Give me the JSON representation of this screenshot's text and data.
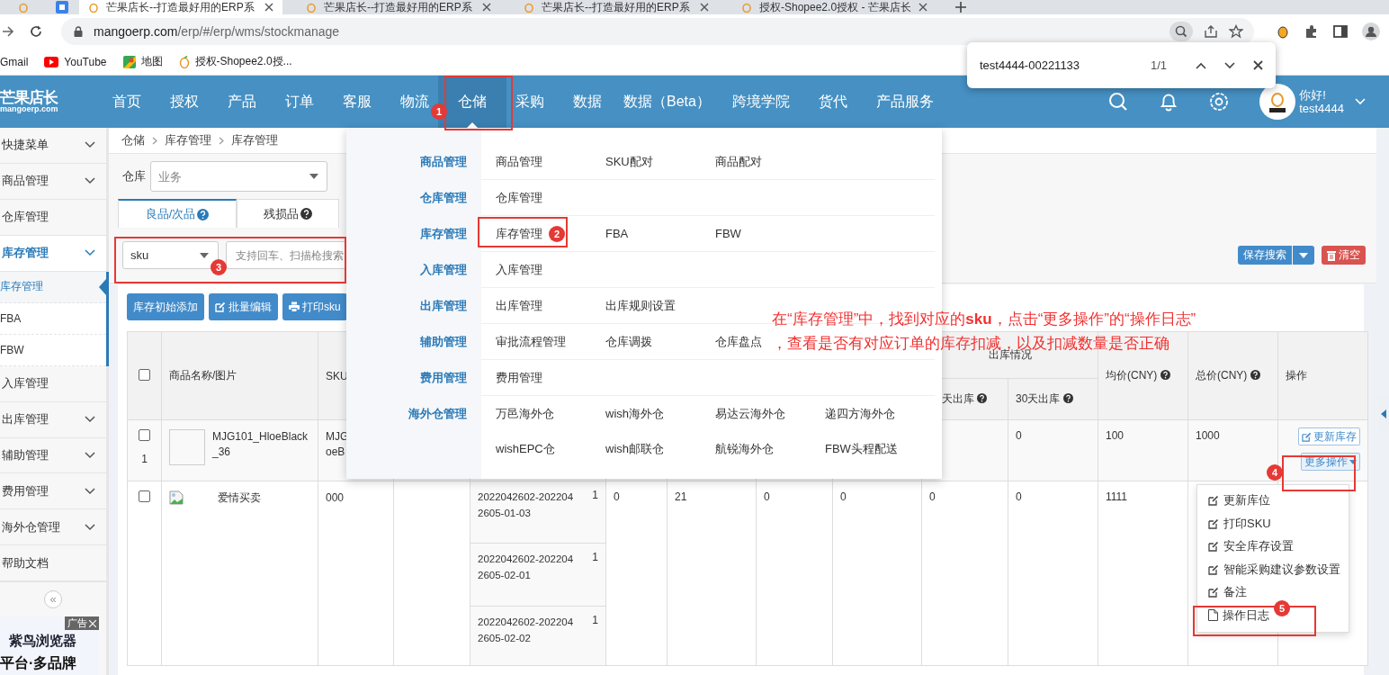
{
  "browser": {
    "tabs": [
      {
        "title": "芒果店长--打造最好用的ERP系",
        "selected": true
      },
      {
        "title": "芒果店长--打造最好用的ERP系",
        "selected": false
      },
      {
        "title": "芒果店长--打造最好用的ERP系",
        "selected": false
      },
      {
        "title": "授权-Shopee2.0授权 - 芒果店长",
        "selected": false
      }
    ],
    "url_host": "mangoerp.com",
    "url_path": "/erp/#/erp/wms/stockmanage",
    "bookmarks": [
      {
        "label": "Gmail",
        "kind": "gmail"
      },
      {
        "label": "YouTube",
        "kind": "youtube"
      },
      {
        "label": "地图",
        "kind": "maps"
      },
      {
        "label": "授权-Shopee2.0授...",
        "kind": "mango"
      }
    ],
    "find_bar": {
      "query": "test4444-00221133",
      "count": "1/1"
    }
  },
  "header": {
    "logo": {
      "name": "芒果店长",
      "domain": "mangoerp.com"
    },
    "nav": [
      {
        "label": "首页",
        "selected": false
      },
      {
        "label": "授权",
        "selected": false
      },
      {
        "label": "产品",
        "selected": false
      },
      {
        "label": "订单",
        "selected": false
      },
      {
        "label": "客服",
        "selected": false
      },
      {
        "label": "物流",
        "selected": false
      },
      {
        "label": "仓储",
        "selected": true
      },
      {
        "label": "采购",
        "selected": false
      },
      {
        "label": "数据",
        "selected": false
      },
      {
        "label": "数据（Beta）",
        "selected": false
      },
      {
        "label": "跨境学院",
        "selected": false
      },
      {
        "label": "货代",
        "selected": false
      },
      {
        "label": "产品服务",
        "selected": false
      }
    ],
    "user": {
      "greeting": "你好!",
      "name": "test4444"
    }
  },
  "sidebar": {
    "items": [
      {
        "label": "快捷菜单",
        "kind": "group",
        "expanded": false,
        "selected": false
      },
      {
        "label": "商品管理",
        "kind": "group",
        "expanded": false,
        "selected": false
      },
      {
        "label": "仓库管理",
        "kind": "link",
        "selected": false
      },
      {
        "label": "库存管理",
        "kind": "group",
        "expanded": true,
        "selected": true,
        "children": [
          {
            "label": "库存管理",
            "selected": true
          },
          {
            "label": "FBA",
            "selected": false
          },
          {
            "label": "FBW",
            "selected": false
          }
        ]
      },
      {
        "label": "入库管理",
        "kind": "link",
        "selected": false
      },
      {
        "label": "出库管理",
        "kind": "group",
        "expanded": false,
        "selected": false
      },
      {
        "label": "辅助管理",
        "kind": "group",
        "expanded": false,
        "selected": false
      },
      {
        "label": "费用管理",
        "kind": "group",
        "expanded": false,
        "selected": false
      },
      {
        "label": "海外仓管理",
        "kind": "group",
        "expanded": false,
        "selected": false
      },
      {
        "label": "帮助文档",
        "kind": "link",
        "selected": false
      }
    ],
    "collapse": "«",
    "ad": {
      "badge": "广告",
      "title": "紫鸟浏览器",
      "subtitle": "平台·多品牌"
    }
  },
  "breadcrumb": [
    "仓储",
    "库存管理",
    "库存管理"
  ],
  "filters": {
    "warehouse": {
      "label": "仓库",
      "placeholder": "业务"
    },
    "tabs": [
      {
        "label": "良品/次品",
        "selected": true
      },
      {
        "label": "残损品",
        "selected": false
      }
    ],
    "search": {
      "field": "sku",
      "placeholder": "支持回车、扫描枪搜索"
    },
    "save_search": "保存搜索",
    "clear": "清空"
  },
  "toolbar": [
    {
      "label": "库存初始添加",
      "kind": "plain"
    },
    {
      "label": "批量编辑",
      "kind": "edit"
    },
    {
      "label": "打印sku",
      "kind": "print"
    }
  ],
  "table": {
    "select_all_checked": false,
    "header": {
      "name": "商品名称/图片",
      "sku": "SKU",
      "outbound_group": "出库情况",
      "outbound_1": "天出库",
      "outbound_2": "30天出库",
      "avg_price": "均价(CNY)",
      "total_price": "总价(CNY)",
      "actions": "操作"
    },
    "rows": [
      {
        "checked": false,
        "number": "1",
        "image": {
          "kind": "placeholder"
        },
        "name": "MJG101_HloeBlack_36",
        "sku": "MJG\noeB",
        "outbound_2": "0",
        "avg_price": "100",
        "total_price": "1000",
        "actions": [
          "更新库存",
          "更多操作"
        ]
      },
      {
        "checked": false,
        "image": {
          "kind": "broken"
        },
        "name": "爱情买卖",
        "sku": "000",
        "batches": [
          {
            "code": "2022042602-2022042605-01-03",
            "qty": "1"
          },
          {
            "code": "2022042602-2022042605-02-01",
            "qty": "1"
          },
          {
            "code": "2022042602-2022042605-02-02",
            "qty": "1"
          }
        ],
        "column_6": "0",
        "column_7": "21",
        "column_8": "0",
        "column_9": "0",
        "outbound_1": "0",
        "outbound_2": "0",
        "avg_price": "1111"
      }
    ]
  },
  "mega_menu": {
    "sections": [
      {
        "label": "商品管理",
        "items": [
          "商品管理",
          "SKU配对",
          "商品配对"
        ]
      },
      {
        "label": "仓库管理",
        "items": [
          "仓库管理"
        ]
      },
      {
        "label": "库存管理",
        "items": [
          "库存管理",
          "FBA",
          "FBW"
        ]
      },
      {
        "label": "入库管理",
        "items": [
          "入库管理"
        ]
      },
      {
        "label": "出库管理",
        "items": [
          "出库管理",
          "出库规则设置"
        ]
      },
      {
        "label": "辅助管理",
        "items": [
          "审批流程管理",
          "仓库调拨",
          "仓库盘点"
        ]
      },
      {
        "label": "费用管理",
        "items": [
          "费用管理"
        ]
      },
      {
        "label": "海外仓管理",
        "items": [
          "万邑海外仓",
          "wish海外仓",
          "易达云海外仓",
          "递四方海外仓",
          "wishEPC仓",
          "wish邮联仓",
          "航锐海外仓",
          "FBW头程配送"
        ]
      }
    ]
  },
  "more_menu": [
    {
      "label": "更新库位",
      "kind": "edit"
    },
    {
      "label": "打印SKU",
      "kind": "edit"
    },
    {
      "label": "安全库存设置",
      "kind": "edit"
    },
    {
      "label": "智能采购建议参数设置",
      "kind": "edit"
    },
    {
      "label": "备注",
      "kind": "edit"
    },
    {
      "label": "操作日志",
      "kind": "file"
    }
  ],
  "annotations": {
    "steps": [
      "1",
      "2",
      "3",
      "4",
      "5"
    ],
    "note": [
      "在“库存管理”中，找到对应的**sku**，点击“更多操作”的“操作日志”",
      "，查看是否有对应订单的库存扣减，以及扣减数量是否正确"
    ]
  }
}
